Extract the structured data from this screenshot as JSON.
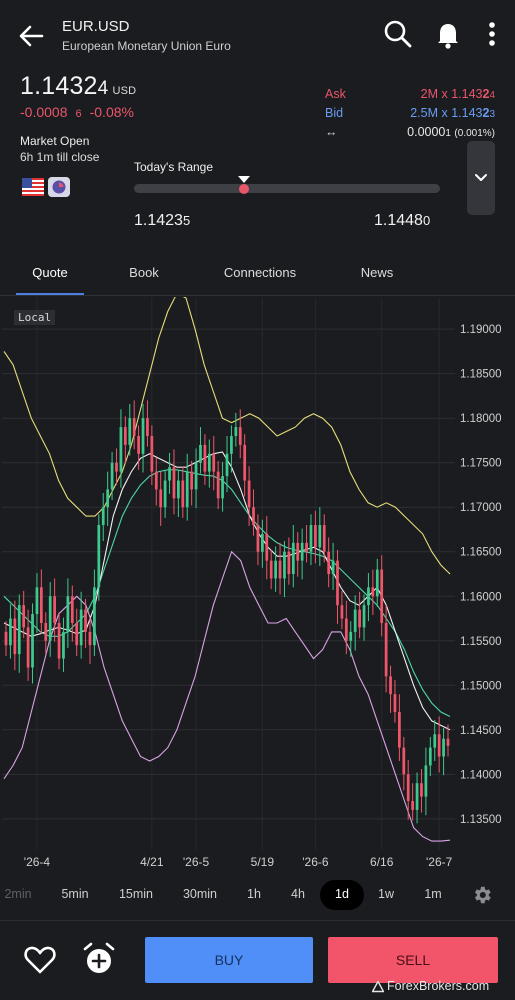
{
  "header": {
    "symbol": "EUR.USD",
    "name": "European Monetary Union Euro"
  },
  "quote": {
    "price_main": "1.1432",
    "price_small": "4",
    "currency": "USD",
    "change_main": "-0.0008",
    "change_small": "6",
    "change_pct": "-0.08%",
    "ask_label": "Ask",
    "ask_size": "2M x 1.143",
    "ask_bold": "2",
    "ask_small": "4",
    "bid_label": "Bid",
    "bid_size": "2.5M x 1.143",
    "bid_bold": "2",
    "bid_small": "3",
    "spread_icon": "↔",
    "spread_main": "0.0000",
    "spread_small": "1",
    "spread_pct": "(0.001%)",
    "market_status": "Market Open",
    "time_to_close": "6h 1m till close",
    "range_label": "Today's Range",
    "range_low_main": "1.1423",
    "range_low_small": "5",
    "range_high_main": "1.1448",
    "range_high_small": "0",
    "range_position": 0.36
  },
  "tabs": [
    "Quote",
    "Book",
    "Connections",
    "News"
  ],
  "chart_badge": "Local",
  "chart_data": {
    "type": "candlestick",
    "y_ticks": [
      "1.19000",
      "1.18500",
      "1.18000",
      "1.17500",
      "1.17000",
      "1.16500",
      "1.16000",
      "1.15500",
      "1.15000",
      "1.14500",
      "1.14000",
      "1.13500"
    ],
    "ylim": [
      1.1315,
      1.1935
    ],
    "x_ticks": [
      "'26-4",
      "4/21",
      "'26-5",
      "5/19",
      "'26-6",
      "6/16",
      "'26-7"
    ],
    "closes": [
      1.1545,
      1.1575,
      1.1535,
      1.159,
      1.1565,
      1.152,
      1.158,
      1.161,
      1.157,
      1.155,
      1.16,
      1.157,
      1.153,
      1.156,
      1.16,
      1.157,
      1.1545,
      1.1585,
      1.156,
      1.1545,
      1.161,
      1.168,
      1.17,
      1.172,
      1.175,
      1.174,
      1.179,
      1.177,
      1.18,
      1.178,
      1.176,
      1.18,
      1.178,
      1.174,
      1.172,
      1.17,
      1.173,
      1.1745,
      1.171,
      1.173,
      1.17,
      1.174,
      1.172,
      1.175,
      1.177,
      1.174,
      1.176,
      1.174,
      1.171,
      1.1735,
      1.176,
      1.178,
      1.179,
      1.177,
      1.173,
      1.17,
      1.168,
      1.165,
      1.167,
      1.164,
      1.162,
      1.164,
      1.162,
      1.165,
      1.1625,
      1.166,
      1.164,
      1.166,
      1.165,
      1.168,
      1.1655,
      1.168,
      1.165,
      1.1625,
      1.164,
      1.159,
      1.1575,
      1.155,
      1.156,
      1.1585,
      1.1565,
      1.159,
      1.161,
      1.16,
      1.163,
      1.157,
      1.151,
      1.149,
      1.147,
      1.143,
      1.14,
      1.137,
      1.136,
      1.139,
      1.1375,
      1.141,
      1.143,
      1.1445,
      1.142,
      1.144,
      1.1432
    ],
    "upper_band": [
      1.1875,
      1.186,
      1.183,
      1.18,
      1.178,
      1.176,
      1.173,
      1.171,
      1.17,
      1.169,
      1.169,
      1.17,
      1.172,
      1.174,
      1.177,
      1.181,
      1.185,
      1.189,
      1.192,
      1.194,
      1.1935,
      1.19,
      1.186,
      1.183,
      1.18,
      1.1795,
      1.18,
      1.1805,
      1.18,
      1.179,
      1.178,
      1.1785,
      1.179,
      1.18,
      1.1805,
      1.18,
      1.179,
      1.177,
      1.174,
      1.172,
      1.1705,
      1.17,
      1.1705,
      1.17,
      1.169,
      1.168,
      1.167,
      1.165,
      1.1635,
      1.1625
    ],
    "lower_band": [
      1.1395,
      1.141,
      1.143,
      1.147,
      1.151,
      1.155,
      1.158,
      1.159,
      1.16,
      1.159,
      1.156,
      1.152,
      1.149,
      1.146,
      1.144,
      1.142,
      1.1415,
      1.142,
      1.143,
      1.145,
      1.148,
      1.151,
      1.155,
      1.159,
      1.162,
      1.165,
      1.164,
      1.161,
      1.159,
      1.157,
      1.157,
      1.1575,
      1.156,
      1.1545,
      1.153,
      1.154,
      1.156,
      1.156,
      1.154,
      1.151,
      1.149,
      1.146,
      1.143,
      1.14,
      1.137,
      1.134,
      1.133,
      1.1325,
      1.1325,
      1.1326
    ],
    "ma_fast": [
      1.157,
      1.1565,
      1.156,
      1.1555,
      1.1558,
      1.1562,
      1.1565,
      1.1562,
      1.1558,
      1.1562,
      1.159,
      1.164,
      1.169,
      1.172,
      1.174,
      1.1755,
      1.176,
      1.1755,
      1.175,
      1.1745,
      1.1745,
      1.175,
      1.1755,
      1.176,
      1.1762,
      1.1745,
      1.172,
      1.169,
      1.167,
      1.1655,
      1.1645,
      1.1645,
      1.1648,
      1.1652,
      1.1655,
      1.165,
      1.163,
      1.161,
      1.1595,
      1.159,
      1.16,
      1.161,
      1.159,
      1.156,
      1.153,
      1.15,
      1.1475,
      1.146,
      1.1455,
      1.145
    ],
    "ma_slow": [
      1.16,
      1.159,
      1.158,
      1.157,
      1.156,
      1.1555,
      1.1555,
      1.156,
      1.157,
      1.158,
      1.16,
      1.163,
      1.166,
      1.169,
      1.171,
      1.1725,
      1.1735,
      1.174,
      1.1742,
      1.1742,
      1.174,
      1.1738,
      1.1736,
      1.1735,
      1.173,
      1.172,
      1.1705,
      1.169,
      1.1678,
      1.1668,
      1.166,
      1.1655,
      1.1652,
      1.165,
      1.1648,
      1.1645,
      1.164,
      1.163,
      1.162,
      1.161,
      1.16,
      1.159,
      1.1575,
      1.156,
      1.154,
      1.1515,
      1.1495,
      1.148,
      1.147,
      1.1465
    ],
    "up_color": "#3ec98f",
    "down_color": "#f0566a",
    "upper_band_color": "#e6dd7a",
    "lower_band_color": "#d9a3e6",
    "ma_fast_color": "#f2f2f2",
    "ma_slow_color": "#4fd6a7"
  },
  "timeframes": [
    "2min",
    "5min",
    "15min",
    "30min",
    "1h",
    "4h",
    "1d",
    "1w",
    "1m"
  ],
  "timeframe_selected": "1d",
  "actions": {
    "buy_label": "BUY",
    "sell_label": "SELL"
  },
  "watermark": "ForexBrokers.com",
  "colors": {
    "ask": "#e8566a",
    "bid": "#6a9cf2",
    "buy": "#4f8ff7",
    "sell": "#f25469",
    "tab_indicator": "#4a7fe0"
  }
}
